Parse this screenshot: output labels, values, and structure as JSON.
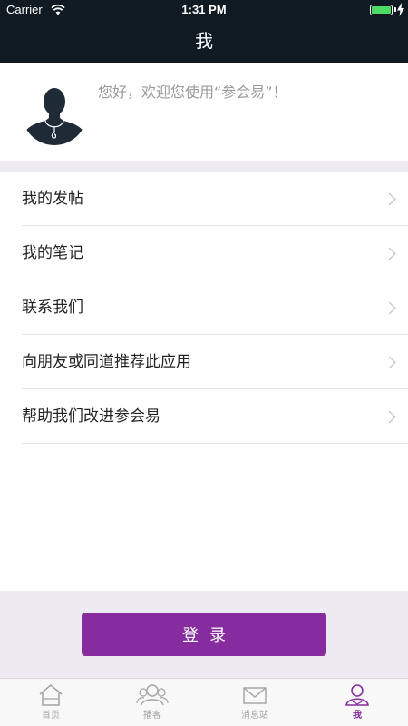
{
  "status_bar": {
    "carrier": "Carrier",
    "time": "1:31 PM"
  },
  "nav": {
    "title": "我"
  },
  "profile": {
    "greeting": "您好，欢迎您使用“参会易”！"
  },
  "menu": {
    "items": [
      {
        "label": "我的发帖"
      },
      {
        "label": "我的笔记"
      },
      {
        "label": "联系我们"
      },
      {
        "label": "向朋友或同道推荐此应用"
      },
      {
        "label": "帮助我们改进参会易"
      }
    ]
  },
  "login": {
    "label": "登录"
  },
  "tabs": [
    {
      "label": "首页",
      "icon": "home-icon"
    },
    {
      "label": "播客",
      "icon": "people-icon"
    },
    {
      "label": "消息站",
      "icon": "mail-icon"
    },
    {
      "label": "我",
      "icon": "person-icon",
      "active": true
    }
  ],
  "colors": {
    "accent": "#872c9e",
    "nav_bg": "#0f1a22",
    "section_bg": "#edeaf1",
    "battery": "#4cd964"
  }
}
